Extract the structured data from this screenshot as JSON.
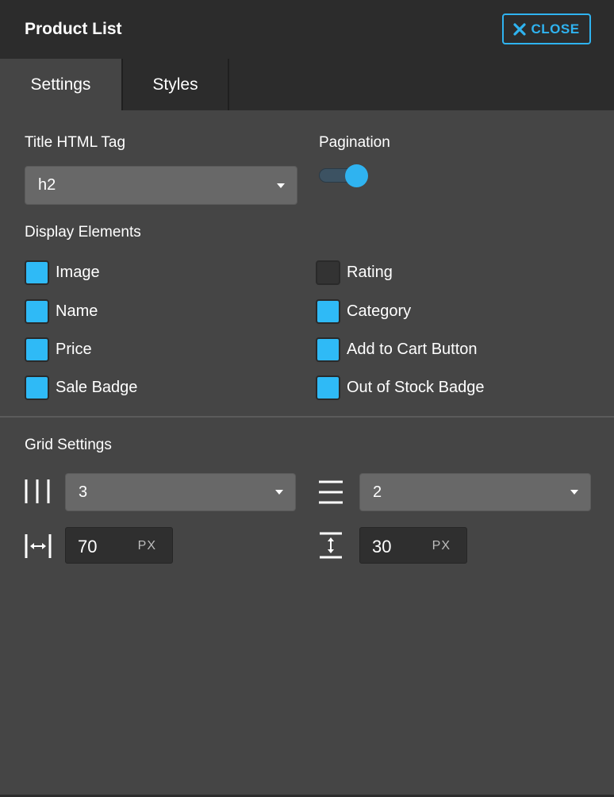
{
  "header": {
    "title": "Product List",
    "close_label": "CLOSE"
  },
  "tabs": [
    {
      "label": "Settings",
      "active": true
    },
    {
      "label": "Styles",
      "active": false
    }
  ],
  "title_tag": {
    "label": "Title HTML Tag",
    "value": "h2"
  },
  "pagination": {
    "label": "Pagination",
    "enabled": true
  },
  "display_elements": {
    "label": "Display Elements",
    "items": [
      {
        "label": "Image",
        "checked": true
      },
      {
        "label": "Rating",
        "checked": false
      },
      {
        "label": "Name",
        "checked": true
      },
      {
        "label": "Category",
        "checked": true
      },
      {
        "label": "Price",
        "checked": true
      },
      {
        "label": "Add to Cart Button",
        "checked": true
      },
      {
        "label": "Sale Badge",
        "checked": true
      },
      {
        "label": "Out of Stock Badge",
        "checked": true
      }
    ]
  },
  "grid": {
    "label": "Grid Settings",
    "columns": "3",
    "rows": "2",
    "column_gap": {
      "value": "70",
      "unit": "PX"
    },
    "row_gap": {
      "value": "30",
      "unit": "PX"
    }
  },
  "colors": {
    "accent": "#2fb3f0",
    "panel": "#454545",
    "header": "#2c2c2c"
  }
}
